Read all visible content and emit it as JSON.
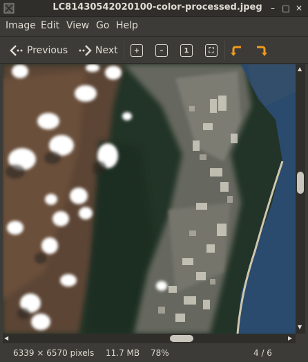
{
  "window": {
    "title": "LC81430542020100-color-processed.jpeg",
    "minimize_glyph": "–",
    "maximize_glyph": "□",
    "close_glyph": "✕"
  },
  "menu": [
    "Image",
    "Edit",
    "View",
    "Go",
    "Help"
  ],
  "toolbar": {
    "previous_label": "Previous",
    "next_label": "Next",
    "zoom_in_icon": "zoom-in-icon",
    "zoom_out_icon": "zoom-out-icon",
    "normal_size_icon": "normal-size-icon",
    "best_fit_icon": "best-fit-icon",
    "rotate_left_icon": "rotate-left-icon",
    "rotate_right_icon": "rotate-right-icon",
    "accent_color": "#f29a1c",
    "zoom_icon_labels": [
      "+",
      "–",
      "1",
      "⛶"
    ]
  },
  "status": {
    "dimensions": "6339 × 6570 pixels",
    "size": "11.7 MB",
    "zoom": "78%",
    "position": "4 / 6"
  },
  "image": {
    "description_hidden": "",
    "colors": {
      "forest": "#213326",
      "land": "#5a4a3a",
      "urban": "#8b8a86",
      "sea": "#2a4a6e",
      "cloud": "#ffffff"
    }
  }
}
